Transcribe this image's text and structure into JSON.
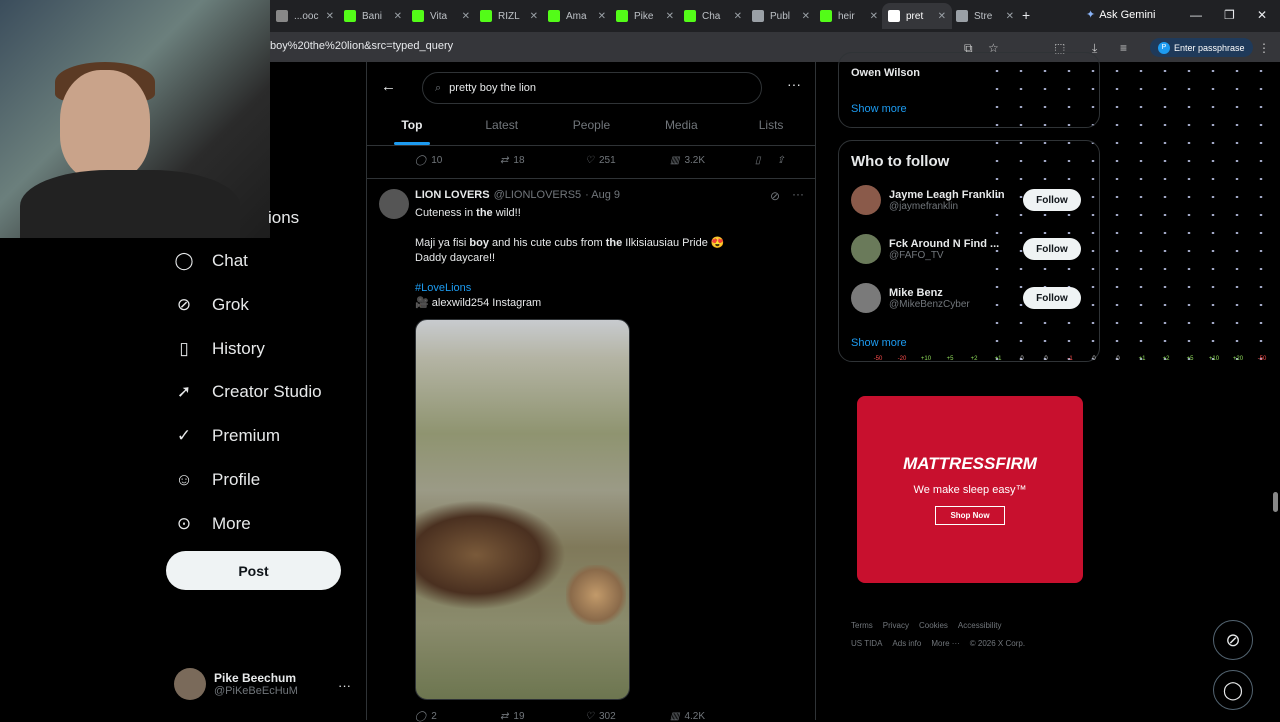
{
  "browser": {
    "tabs": [
      {
        "label": "...ooc",
        "color": "#888888"
      },
      {
        "label": "Bani",
        "color": "#53fc18"
      },
      {
        "label": "Vita",
        "color": "#53fc18"
      },
      {
        "label": "RIZL",
        "color": "#53fc18"
      },
      {
        "label": "Ama",
        "color": "#53fc18"
      },
      {
        "label": "Pike",
        "color": "#53fc18"
      },
      {
        "label": "Cha",
        "color": "#53fc18"
      },
      {
        "label": "Publ",
        "color": "#9aa0a6"
      },
      {
        "label": "heir",
        "color": "#53fc18"
      },
      {
        "label": "pret",
        "color": "#ffffff"
      },
      {
        "label": "Stre",
        "color": "#9aa0a6"
      }
    ],
    "url": "boy%20the%20lion&src=typed_query",
    "gemini_label": "Ask Gemini",
    "passphrase_label": "Enter passphrase",
    "passphrase_badge": "P"
  },
  "nav": {
    "partial_label": "ions",
    "items": [
      {
        "label": "Chat",
        "icon": "chat-icon"
      },
      {
        "label": "Grok",
        "icon": "grok-icon"
      },
      {
        "label": "History",
        "icon": "bookmark-icon"
      },
      {
        "label": "Creator Studio",
        "icon": "rocket-icon"
      },
      {
        "label": "Premium",
        "icon": "verified-icon"
      },
      {
        "label": "Profile",
        "icon": "person-icon"
      },
      {
        "label": "More",
        "icon": "more-icon"
      }
    ],
    "post_label": "Post",
    "account": {
      "name": "Pike Beechum",
      "handle": "@PiKeBeEcHuM"
    }
  },
  "search": {
    "query": "pretty boy the lion",
    "tabs": [
      "Top",
      "Latest",
      "People",
      "Media",
      "Lists"
    ],
    "active_tab": "Top"
  },
  "prev_tweet_actions": {
    "replies": "10",
    "reposts": "18",
    "likes": "251",
    "views": "3.2K"
  },
  "tweet": {
    "name": "LION LOVERS",
    "handle": "@LIONLOVERS5",
    "date": "· Aug 9",
    "line1_pre": "Cuteness in ",
    "line1_bold": "the",
    "line1_post": " wild!!",
    "line2_a": "Maji ya fisi ",
    "line2_b": "boy",
    "line2_c": " and his cute cubs from ",
    "line2_d": "the",
    "line2_e": " Ilkisiausiau Pride 😍",
    "line3": "Daddy daycare!!",
    "hashtag": "#LoveLions",
    "credit": "🎥 alexwild254 Instagram",
    "actions": {
      "replies": "2",
      "reposts": "19",
      "likes": "302",
      "views": "4.2K"
    }
  },
  "sidebar": {
    "trend_name": "Owen Wilson",
    "show_more": "Show more",
    "who_to_follow_title": "Who to follow",
    "follow_label": "Follow",
    "suggestions": [
      {
        "name": "Jayme Leagh Franklin",
        "handle": "@jaymefranklin"
      },
      {
        "name": "Fck Around N Find ...",
        "handle": "@FAFO_TV"
      },
      {
        "name": "Mike Benz",
        "handle": "@MikeBenzCyber"
      }
    ],
    "show_more_2": "Show more"
  },
  "ad": {
    "brand": "MATTRESSFIRM",
    "tagline": "We make sleep easy™",
    "cta": "Shop Now"
  },
  "footer": {
    "links": [
      "Terms",
      "Privacy",
      "Cookies",
      "Accessibility"
    ],
    "links2": [
      "US TIDA",
      "Ads info",
      "More ···",
      "© 2026 X Corp."
    ]
  },
  "meter": [
    "-50",
    "-20",
    "+10",
    "+5",
    "+2",
    "+1",
    "0",
    "0",
    "-1",
    "0",
    "0",
    "+1",
    "+2",
    "+5",
    "+10",
    "+20",
    "-50"
  ]
}
